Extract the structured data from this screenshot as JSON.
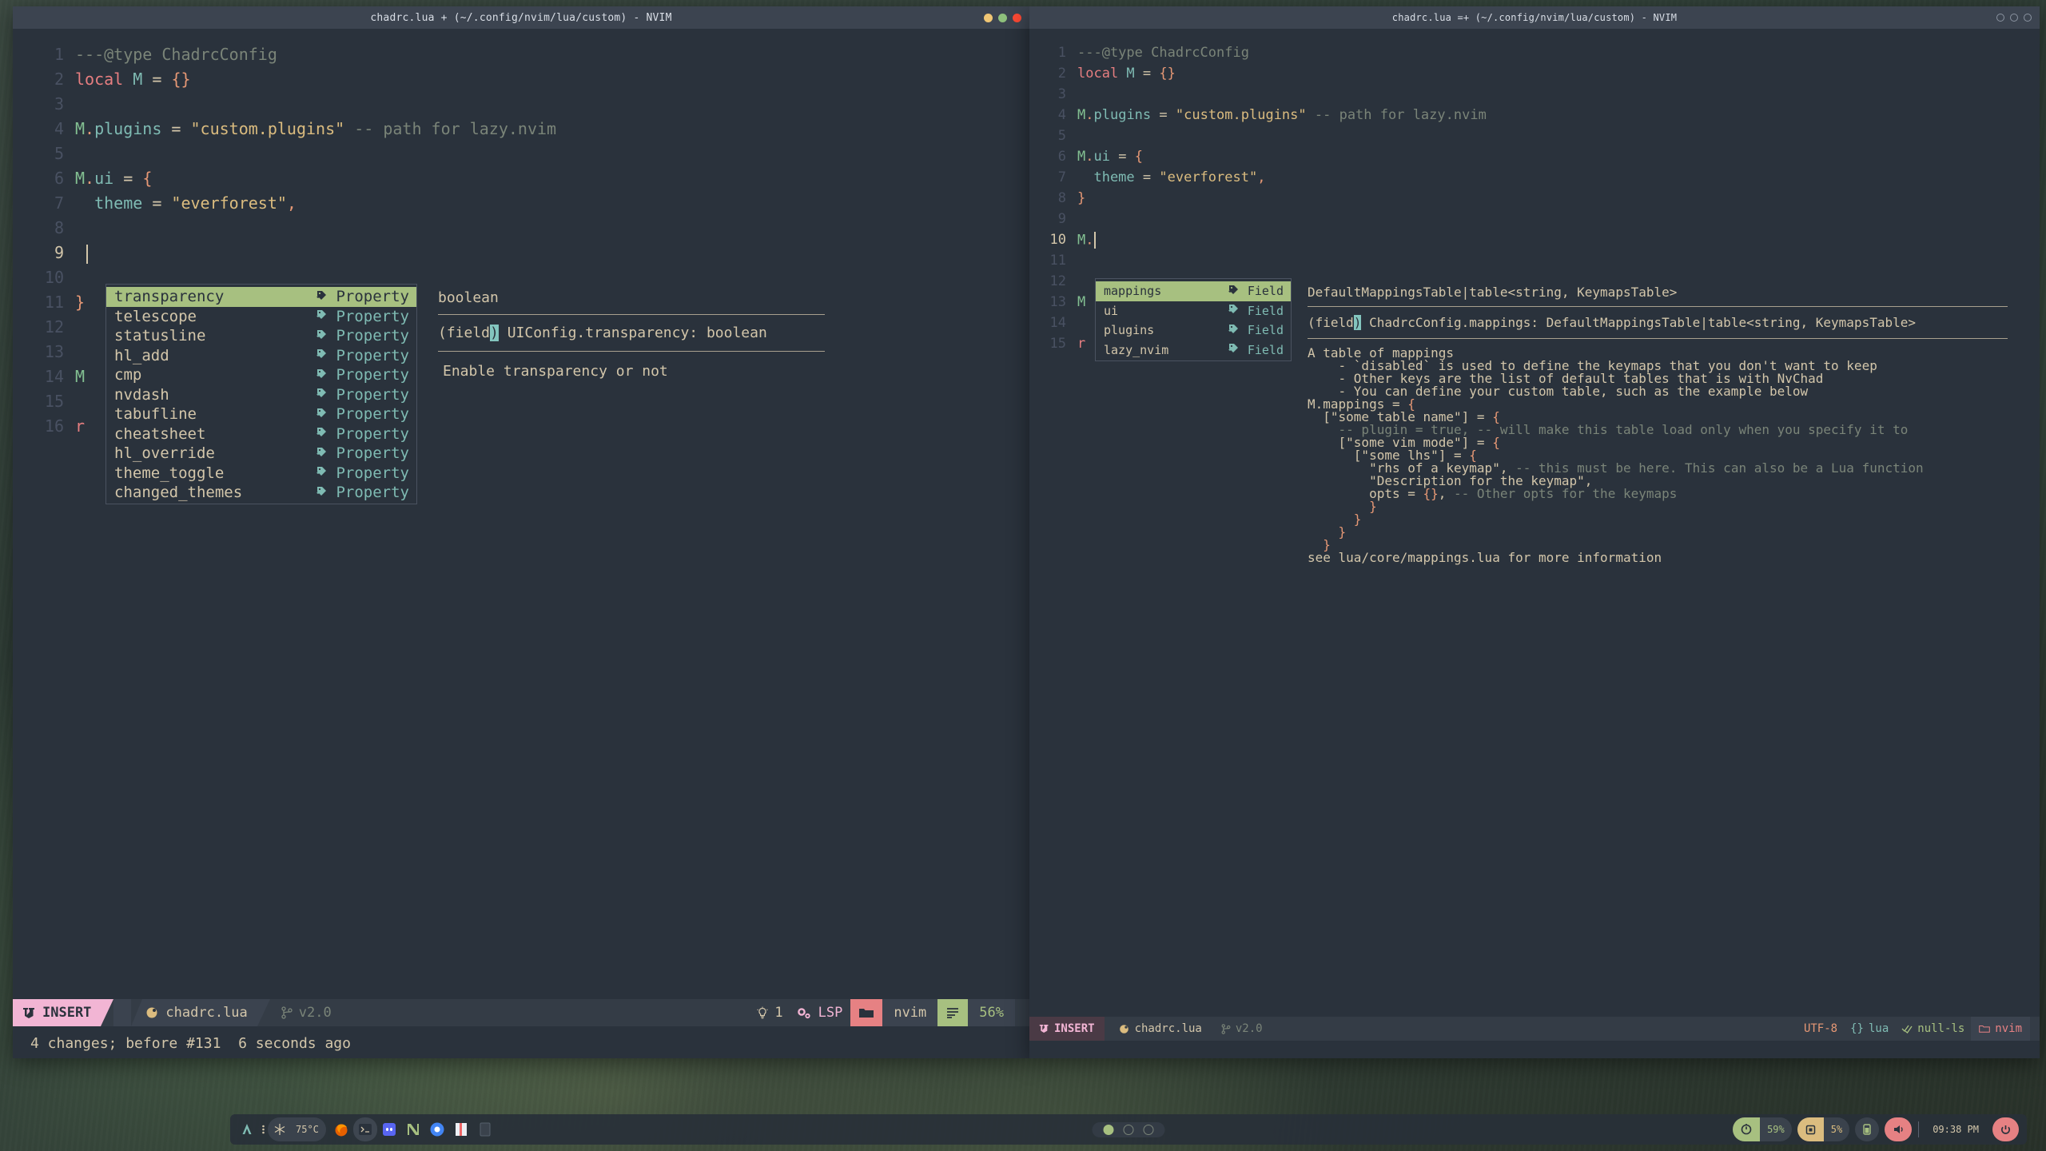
{
  "left_window": {
    "title": "chadrc.lua + (~/.config/nvim/lua/custom) - NVIM",
    "lines": [
      {
        "n": "1",
        "segments": [
          {
            "t": "---@type ChadrcConfig",
            "c": "com"
          }
        ]
      },
      {
        "n": "2",
        "segments": [
          {
            "t": "local",
            "c": "kw"
          },
          {
            "t": " M ",
            "c": "cyan"
          },
          {
            "t": "= ",
            "c": "var"
          },
          {
            "t": "{}",
            "c": "pun"
          }
        ]
      },
      {
        "n": "3",
        "segments": []
      },
      {
        "n": "4",
        "segments": [
          {
            "t": "M",
            "c": "id"
          },
          {
            "t": ".",
            "c": "pun"
          },
          {
            "t": "plugins ",
            "c": "cyan"
          },
          {
            "t": "= ",
            "c": "var"
          },
          {
            "t": "\"custom.plugins\"",
            "c": "str"
          },
          {
            "t": " -- path for lazy.nvim",
            "c": "com"
          }
        ]
      },
      {
        "n": "5",
        "segments": []
      },
      {
        "n": "6",
        "segments": [
          {
            "t": "M",
            "c": "id"
          },
          {
            "t": ".",
            "c": "pun"
          },
          {
            "t": "ui ",
            "c": "cyan"
          },
          {
            "t": "= ",
            "c": "var"
          },
          {
            "t": "{",
            "c": "pun"
          }
        ]
      },
      {
        "n": "7",
        "segments": [
          {
            "t": "  theme ",
            "c": "cyan"
          },
          {
            "t": "= ",
            "c": "var"
          },
          {
            "t": "\"everforest\"",
            "c": "str"
          },
          {
            "t": ",",
            "c": "pun"
          }
        ]
      },
      {
        "n": "8",
        "segments": []
      },
      {
        "n": "9",
        "segments": []
      },
      {
        "n": "10",
        "segments": []
      },
      {
        "n": "11",
        "segments": [
          {
            "t": "}",
            "c": "pun"
          }
        ]
      },
      {
        "n": "12",
        "segments": []
      },
      {
        "n": "13",
        "segments": []
      },
      {
        "n": "14",
        "segments": [
          {
            "t": "M",
            "c": "id"
          }
        ]
      },
      {
        "n": "15",
        "segments": []
      },
      {
        "n": "16",
        "segments": [
          {
            "t": "r",
            "c": "kw"
          }
        ]
      }
    ],
    "cursor_line": "9",
    "completion": {
      "items": [
        {
          "label": "transparency",
          "kind": "Property",
          "selected": true
        },
        {
          "label": "telescope",
          "kind": "Property",
          "selected": false
        },
        {
          "label": "statusline",
          "kind": "Property",
          "selected": false
        },
        {
          "label": "hl_add",
          "kind": "Property",
          "selected": false
        },
        {
          "label": "cmp",
          "kind": "Property",
          "selected": false
        },
        {
          "label": "nvdash",
          "kind": "Property",
          "selected": false
        },
        {
          "label": "tabufline",
          "kind": "Property",
          "selected": false
        },
        {
          "label": "cheatsheet",
          "kind": "Property",
          "selected": false
        },
        {
          "label": "hl_override",
          "kind": "Property",
          "selected": false
        },
        {
          "label": "theme_toggle",
          "kind": "Property",
          "selected": false
        },
        {
          "label": "changed_themes",
          "kind": "Property",
          "selected": false
        }
      ],
      "icon": "property-tag-icon"
    },
    "doc": {
      "type_line": "boolean",
      "signature_prefix": "(field",
      "signature_cursor": ")",
      "signature_rest": " UIConfig.transparency: boolean",
      "description": "Enable transparency or not"
    },
    "statusline": {
      "mode": "INSERT",
      "mode_icon": "vim-icon",
      "file_icon": "lua-icon",
      "filename": "chadrc.lua",
      "branch_icon": "git-branch-icon",
      "branch": "v2.0",
      "diagnostic_icon": "lightbulb-icon",
      "diagnostic_count": "1",
      "lsp_icon": "gears-icon",
      "lsp_label": "LSP",
      "folder_icon": "folder-icon",
      "cwd": "nvim",
      "lines_icon": "lines-icon",
      "percent": "56%"
    },
    "cmdline": "4 changes; before #131  6 seconds ago"
  },
  "right_window": {
    "title": "chadrc.lua =+ (~/.config/nvim/lua/custom) - NVIM",
    "lines": [
      {
        "n": "1",
        "segments": [
          {
            "t": "---@type ChadrcConfig",
            "c": "com"
          }
        ]
      },
      {
        "n": "2",
        "segments": [
          {
            "t": "local",
            "c": "kw"
          },
          {
            "t": " M ",
            "c": "cyan"
          },
          {
            "t": "= ",
            "c": "var"
          },
          {
            "t": "{}",
            "c": "pun"
          }
        ]
      },
      {
        "n": "3",
        "segments": []
      },
      {
        "n": "4",
        "segments": [
          {
            "t": "M",
            "c": "id"
          },
          {
            "t": ".",
            "c": "pun"
          },
          {
            "t": "plugins ",
            "c": "cyan"
          },
          {
            "t": "= ",
            "c": "var"
          },
          {
            "t": "\"custom.plugins\"",
            "c": "str"
          },
          {
            "t": " -- path for lazy.nvim",
            "c": "com"
          }
        ]
      },
      {
        "n": "5",
        "segments": []
      },
      {
        "n": "6",
        "segments": [
          {
            "t": "M",
            "c": "id"
          },
          {
            "t": ".",
            "c": "pun"
          },
          {
            "t": "ui ",
            "c": "cyan"
          },
          {
            "t": "= ",
            "c": "var"
          },
          {
            "t": "{",
            "c": "pun"
          }
        ]
      },
      {
        "n": "7",
        "segments": [
          {
            "t": "  theme ",
            "c": "cyan"
          },
          {
            "t": "= ",
            "c": "var"
          },
          {
            "t": "\"everforest\"",
            "c": "str"
          },
          {
            "t": ",",
            "c": "pun"
          }
        ]
      },
      {
        "n": "8",
        "segments": [
          {
            "t": "}",
            "c": "pun"
          }
        ]
      },
      {
        "n": "9",
        "segments": []
      },
      {
        "n": "10",
        "segments": [
          {
            "t": "M",
            "c": "id"
          },
          {
            "t": ".",
            "c": "pun"
          }
        ]
      },
      {
        "n": "11",
        "segments": []
      },
      {
        "n": "12",
        "segments": []
      },
      {
        "n": "13",
        "segments": [
          {
            "t": "M",
            "c": "id"
          }
        ]
      },
      {
        "n": "14",
        "segments": []
      },
      {
        "n": "15",
        "segments": [
          {
            "t": "r",
            "c": "kw"
          }
        ]
      }
    ],
    "cursor_line": "10",
    "completion": {
      "items": [
        {
          "label": "mappings",
          "kind": "Field",
          "selected": true
        },
        {
          "label": "ui",
          "kind": "Field",
          "selected": false
        },
        {
          "label": "plugins",
          "kind": "Field",
          "selected": false
        },
        {
          "label": "lazy_nvim",
          "kind": "Field",
          "selected": false
        }
      ],
      "icon": "field-tag-icon"
    },
    "doc": {
      "type_line": "DefaultMappingsTable|table<string, KeymapsTable>",
      "signature_prefix": "(field",
      "signature_cursor": ")",
      "signature_rest": " ChadrcConfig.mappings: DefaultMappingsTable|table<string, KeymapsTable>",
      "body": [
        [
          {
            "t": "A table of mappings",
            "c": "var"
          }
        ],
        [
          {
            "t": "    - `disabled` is used to define the keymaps that you don't want to keep",
            "c": "var"
          }
        ],
        [
          {
            "t": "    - Other keys are the list of default tables that is with NvChad",
            "c": "var"
          }
        ],
        [
          {
            "t": "    - You can define your custom table, such as the example below",
            "c": "var"
          }
        ],
        [
          {
            "t": "M.mappings = ",
            "c": "var"
          },
          {
            "t": "{",
            "c": "pun"
          }
        ],
        [
          {
            "t": "  [\"some table name\"] = ",
            "c": "var"
          },
          {
            "t": "{",
            "c": "pun"
          }
        ],
        [
          {
            "t": "    -- plugin = true, -- will make this table load only when you specify it to",
            "c": "com"
          }
        ],
        [
          {
            "t": "    [\"some vim mode\"] = ",
            "c": "var"
          },
          {
            "t": "{",
            "c": "pun"
          }
        ],
        [
          {
            "t": "      [\"some lhs\"] = ",
            "c": "var"
          },
          {
            "t": "{",
            "c": "pun"
          }
        ],
        [
          {
            "t": "        \"rhs of a keymap\", ",
            "c": "var"
          },
          {
            "t": "-- this must be here. This can also be a Lua function",
            "c": "com"
          }
        ],
        [
          {
            "t": "        \"Description for the keymap\",",
            "c": "var"
          }
        ],
        [
          {
            "t": "        opts = ",
            "c": "var"
          },
          {
            "t": "{}",
            "c": "pun"
          },
          {
            "t": ", ",
            "c": "var"
          },
          {
            "t": "-- Other opts for the keymaps",
            "c": "com"
          }
        ],
        [
          {
            "t": "        ",
            "c": "var"
          },
          {
            "t": "}",
            "c": "pun"
          }
        ],
        [
          {
            "t": "      ",
            "c": "var"
          },
          {
            "t": "}",
            "c": "pun"
          }
        ],
        [
          {
            "t": "    ",
            "c": "var"
          },
          {
            "t": "}",
            "c": "pun"
          }
        ],
        [
          {
            "t": "  ",
            "c": "var"
          },
          {
            "t": "}",
            "c": "pun"
          }
        ],
        [
          {
            "t": "see lua/core/mappings.lua for more information",
            "c": "var"
          }
        ]
      ]
    },
    "statusline": {
      "mode": "INSERT",
      "mode_icon": "vim-icon",
      "file_icon": "lua-icon",
      "filename": "chadrc.lua",
      "branch_icon": "git-branch-icon",
      "branch": "v2.0",
      "encoding": "UTF-8",
      "filetype_icon": "braces-icon",
      "filetype": "lua",
      "linter_icon": "check-icon",
      "linter": "null-ls",
      "folder_icon": "folder-icon",
      "cwd": "nvim"
    }
  },
  "taskbar": {
    "left_items": [
      {
        "name": "arch-logo-icon",
        "label": ""
      },
      {
        "name": "grip-icon",
        "label": ""
      },
      {
        "name": "snowflake-icon",
        "label": ""
      },
      {
        "name": "temperature",
        "label": "75°C"
      },
      {
        "name": "firefox-icon",
        "label": ""
      },
      {
        "name": "terminal-icon",
        "label": ""
      },
      {
        "name": "discord-icon",
        "label": ""
      },
      {
        "name": "nvim-icon",
        "label": ""
      },
      {
        "name": "chrome-icon",
        "label": ""
      },
      {
        "name": "files-icon",
        "label": ""
      },
      {
        "name": "notes-icon",
        "label": ""
      }
    ],
    "workspaces": [
      {
        "name": "workspace-1",
        "active": true
      },
      {
        "name": "workspace-2",
        "active": false
      },
      {
        "name": "workspace-3",
        "active": false
      }
    ],
    "right": {
      "cpu_icon": "cpu-icon",
      "cpu": "59%",
      "ram_icon": "ram-icon",
      "ram": "5%",
      "battery_icon": "battery-icon",
      "volume_icon": "volume-icon",
      "clock": "09:38 PM",
      "power_icon": "power-icon"
    }
  }
}
